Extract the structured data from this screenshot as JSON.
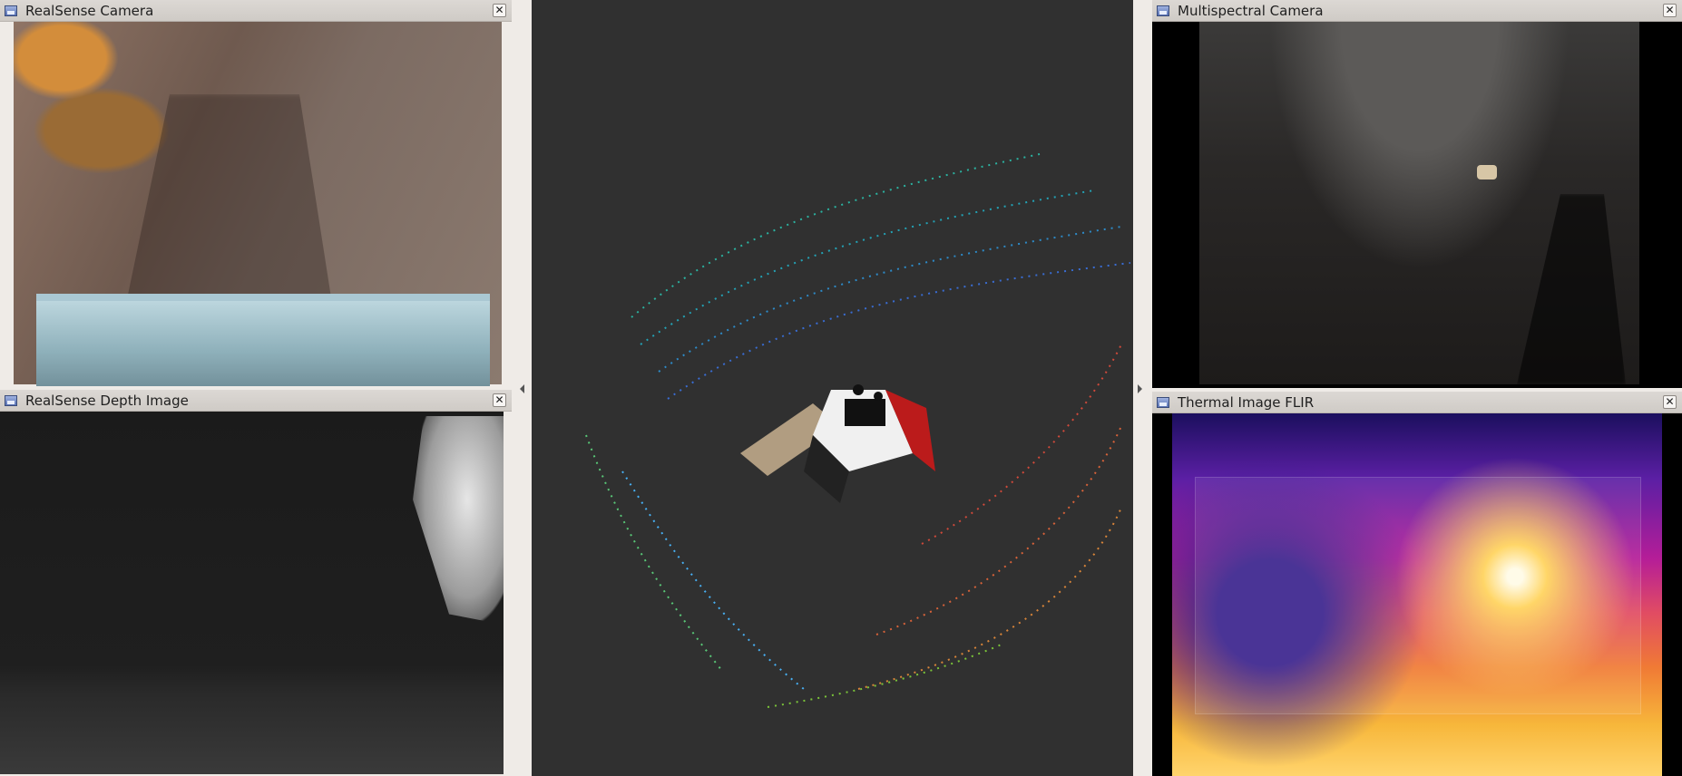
{
  "panels": {
    "realsense_camera": {
      "title": "RealSense Camera"
    },
    "realsense_depth": {
      "title": "RealSense Depth Image"
    },
    "multispectral": {
      "title": "Multispectral Camera"
    },
    "thermal": {
      "title": "Thermal Image FLIR"
    }
  },
  "ui": {
    "close_glyph": "✕",
    "left_arrow": "◂",
    "right_arrow": "▸"
  },
  "colors": {
    "bg": "#efebe7",
    "viz_bg": "#303030"
  }
}
